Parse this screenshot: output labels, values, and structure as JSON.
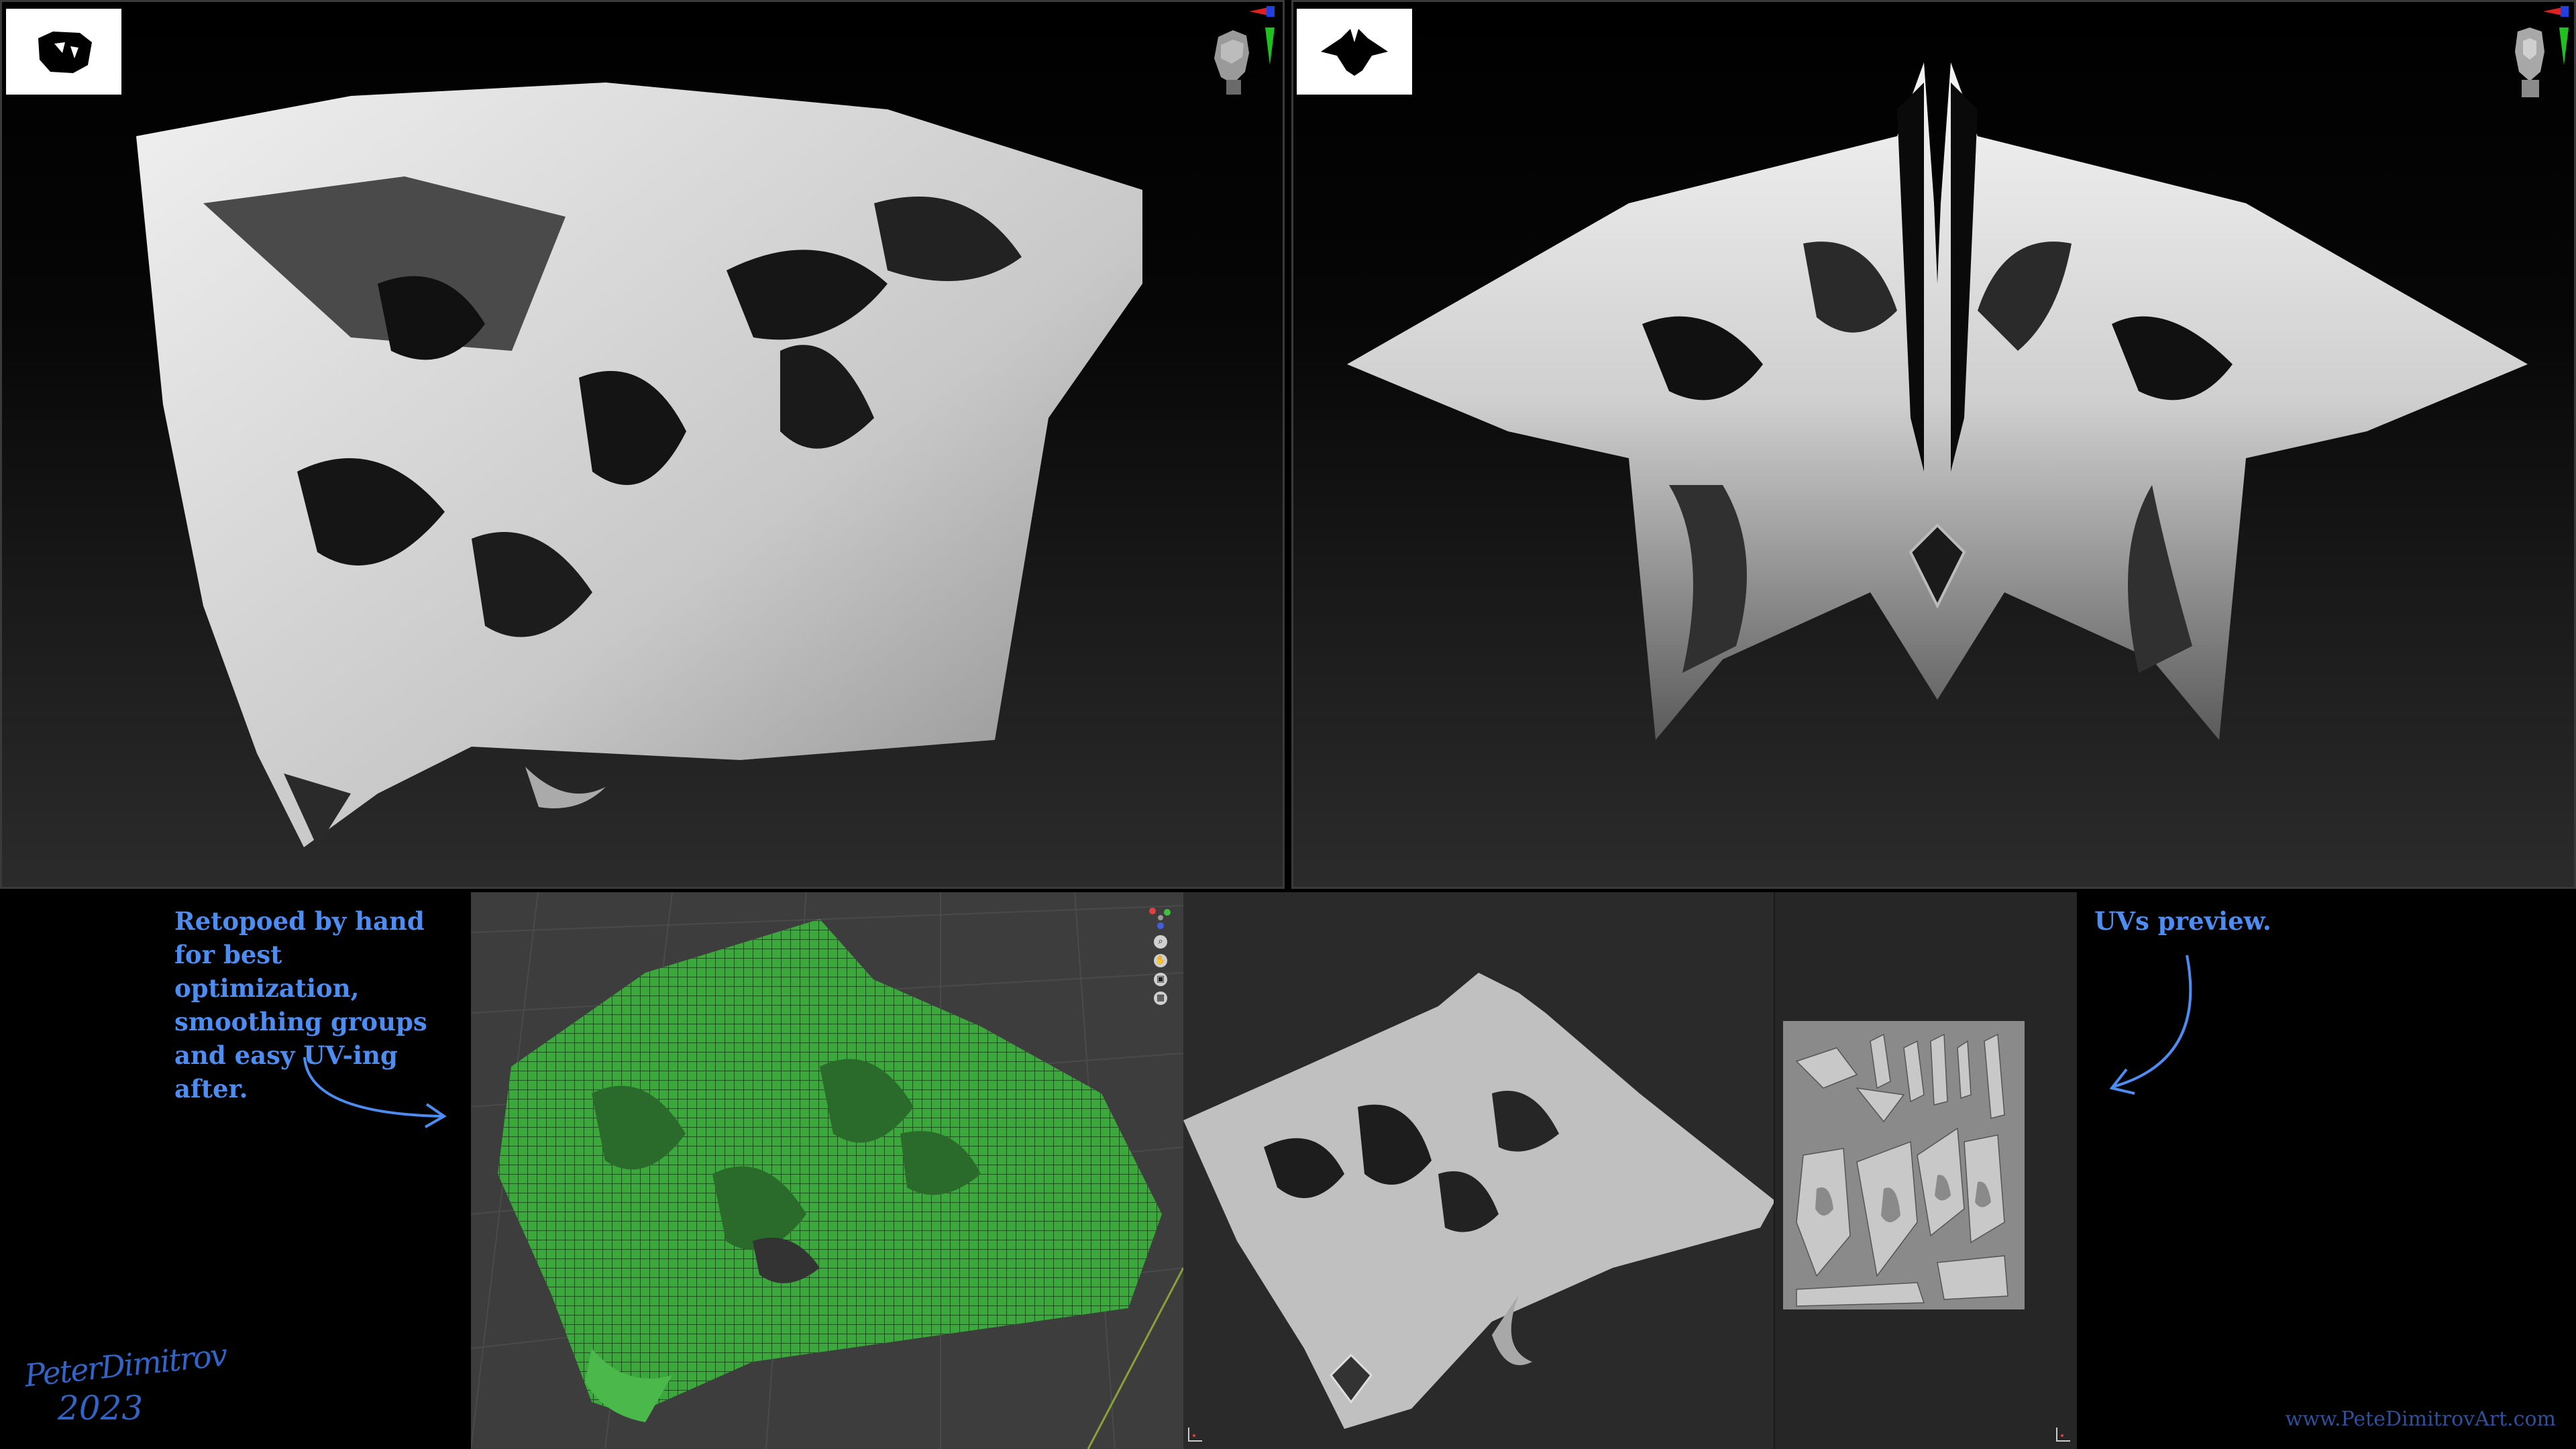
{
  "annotations": {
    "retopo": "Retopoed by hand\nfor best optimization,\nsmoothing groups\nand easy UV-ing after.",
    "uvs": "UVs preview."
  },
  "signature": {
    "name": "PeterDimitrov",
    "year": "2023"
  },
  "website": "www.PeteDimitrovArt.com",
  "colors": {
    "annotation_blue": "#4d8cf0",
    "signature_blue": "#3264c8",
    "wireframe_green": "#3aa83a",
    "sculpt_grey": "#d8d8d8",
    "axis_red": "#e02020",
    "axis_green": "#20c020",
    "axis_blue": "#2040e0"
  },
  "icons": {
    "left_thumb": "sculpt-silhouette-icon",
    "right_thumb": "sculpt-silhouette-icon",
    "left_gizmo": "head-orientation-gizmo-icon",
    "right_gizmo": "head-orientation-gizmo-icon",
    "blender_nav": [
      "axis-gizmo-icon",
      "zoom-icon",
      "pan-hand-icon",
      "camera-icon",
      "grid-icon"
    ]
  }
}
